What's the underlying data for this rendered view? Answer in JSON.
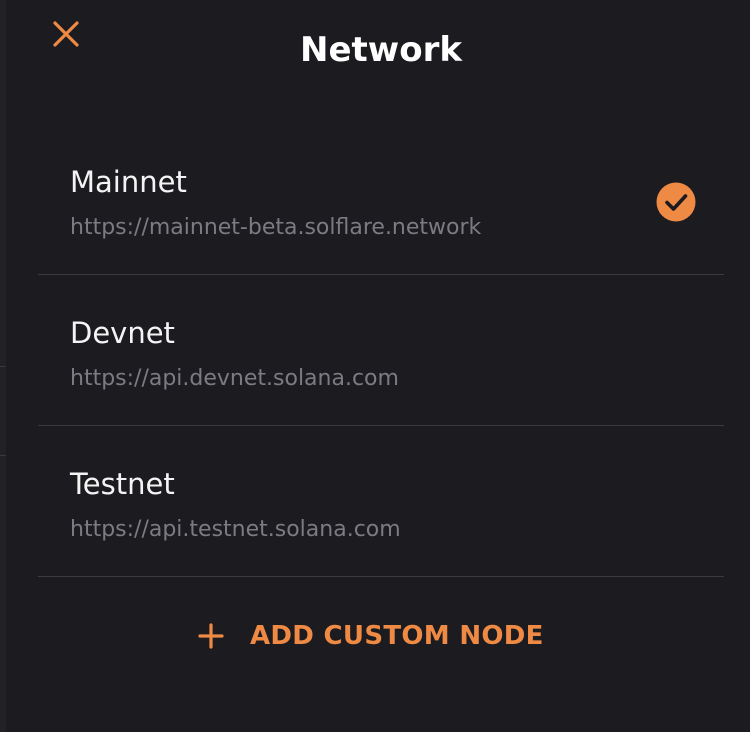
{
  "header": {
    "title": "Network",
    "close_icon": "close-icon"
  },
  "networks": [
    {
      "name": "Mainnet",
      "url": "https://mainnet-beta.solflare.network",
      "selected": true
    },
    {
      "name": "Devnet",
      "url": "https://api.devnet.solana.com",
      "selected": false
    },
    {
      "name": "Testnet",
      "url": "https://api.testnet.solana.com",
      "selected": false
    }
  ],
  "add_custom_node": {
    "label": "ADD CUSTOM NODE",
    "icon": "plus-icon"
  },
  "colors": {
    "background": "#1c1b20",
    "accent": "#ef8a45",
    "divider": "#3b3a40",
    "text_primary": "#f4f4f5",
    "text_secondary": "#7c7b82"
  }
}
